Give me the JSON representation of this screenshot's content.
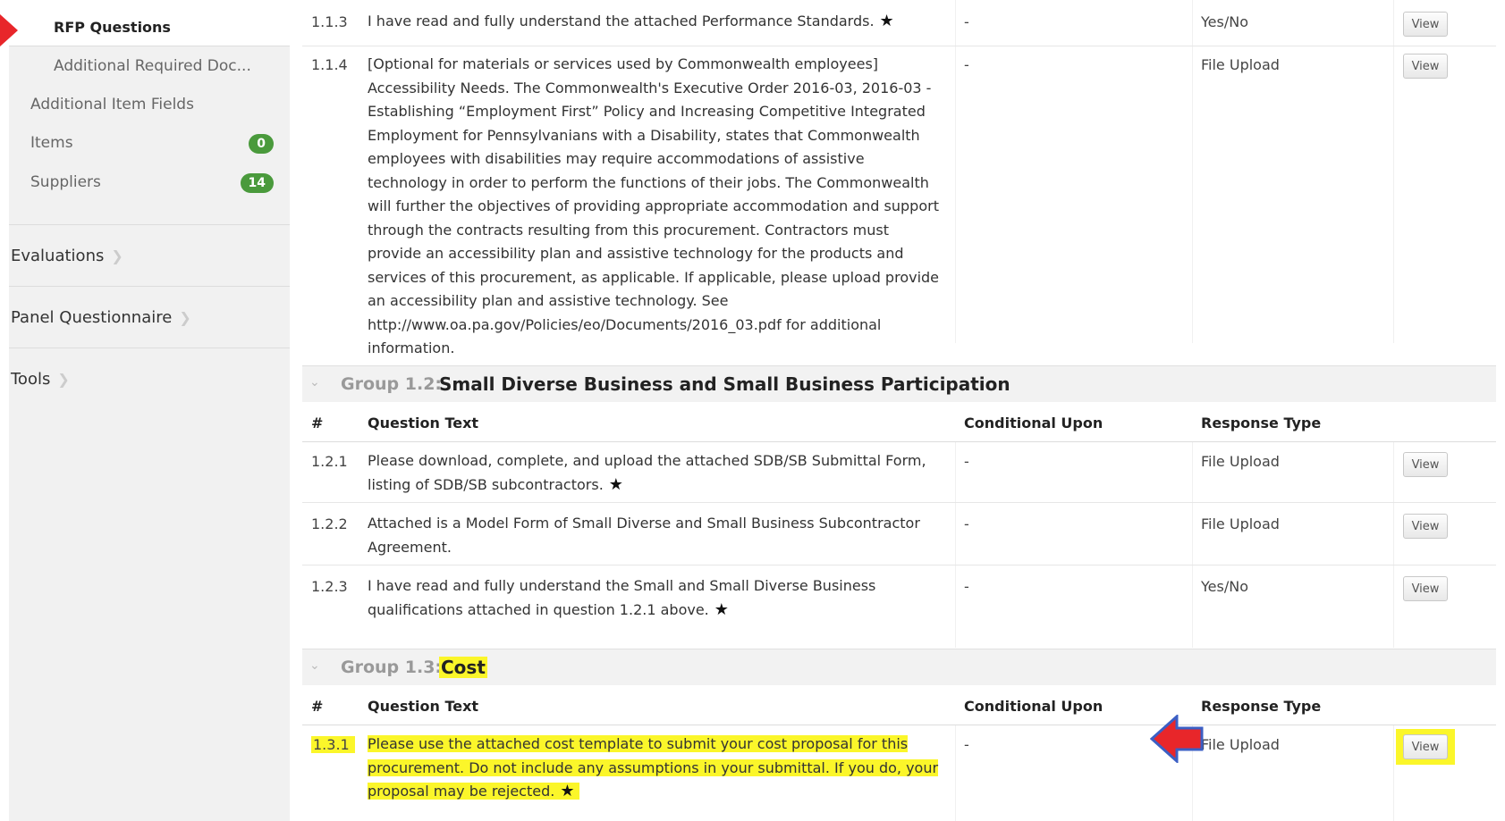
{
  "sidebar": {
    "active": "RFP Questions",
    "sub_items": [
      {
        "label": "Additional Required Doc..."
      },
      {
        "label": "Additional Item Fields"
      },
      {
        "label": "Items",
        "badge": "0"
      },
      {
        "label": "Suppliers",
        "badge": "14"
      }
    ],
    "sections": [
      {
        "label": "Evaluations"
      },
      {
        "label": "Panel Questionnaire"
      },
      {
        "label": "Tools"
      }
    ]
  },
  "columns": {
    "num": "#",
    "question": "Question Text",
    "conditional": "Conditional Upon",
    "response": "Response Type"
  },
  "view_label": "View",
  "top_rows": [
    {
      "num": "1.1.3",
      "text": "I have read and fully understand the attached Performance Standards.",
      "star": "★",
      "cond": "-",
      "type": "Yes/No"
    },
    {
      "num": "1.1.4",
      "text": "[Optional for materials or services used by Commonwealth employees] Accessibility Needs. The Commonwealth's Executive Order 2016-03, 2016-03 - Establishing “Employment First” Policy and Increasing Competitive Integrated Employment for Pennsylvanians with a Disability, states that Commonwealth employees with disabilities may require accommodations of assistive technology in order to perform the functions of their jobs. The Commonwealth will further the objectives of providing appropriate accommodation and support through the contracts resulting from this procurement. Contractors must provide an accessibility plan and assistive technology for the products and services of this procurement, as applicable. If applicable, please upload provide an accessibility plan and assistive technology. See http://www.oa.pa.gov/Policies/eo/Documents/2016_03.pdf for additional information.",
      "cond": "-",
      "type": "File Upload"
    }
  ],
  "group2": {
    "label": "Group 1.2:",
    "title": "Small Diverse Business and Small Business Participation",
    "rows": [
      {
        "num": "1.2.1",
        "text": "Please download, complete, and upload the attached SDB/SB Submittal Form, listing of SDB/SB subcontractors.",
        "star": "★",
        "cond": "-",
        "type": "File Upload"
      },
      {
        "num": "1.2.2",
        "text": "Attached is a Model Form of Small Diverse and Small Business Subcontractor Agreement.",
        "cond": "-",
        "type": "File Upload"
      },
      {
        "num": "1.2.3",
        "text": "I have read and fully understand the Small and Small Diverse Business qualifications attached in question 1.2.1 above.",
        "star": "★",
        "cond": "-",
        "type": "Yes/No"
      }
    ]
  },
  "group3": {
    "label": "Group 1.3:",
    "title": "Cost",
    "rows": [
      {
        "num": "1.3.1",
        "line1": "Please use the attached cost template to submit your cost proposal for this",
        "line2": "procurement. Do not include any assumptions in your submittal. If you do, your",
        "line3": "proposal may be rejected.",
        "star": "★",
        "cond": "-",
        "type": "File Upload"
      }
    ]
  },
  "colors": {
    "badge": "#4a9a3c",
    "highlight": "#fbf62a",
    "arrow": "#e8262a",
    "arrow_outline": "#3b5fc4"
  }
}
